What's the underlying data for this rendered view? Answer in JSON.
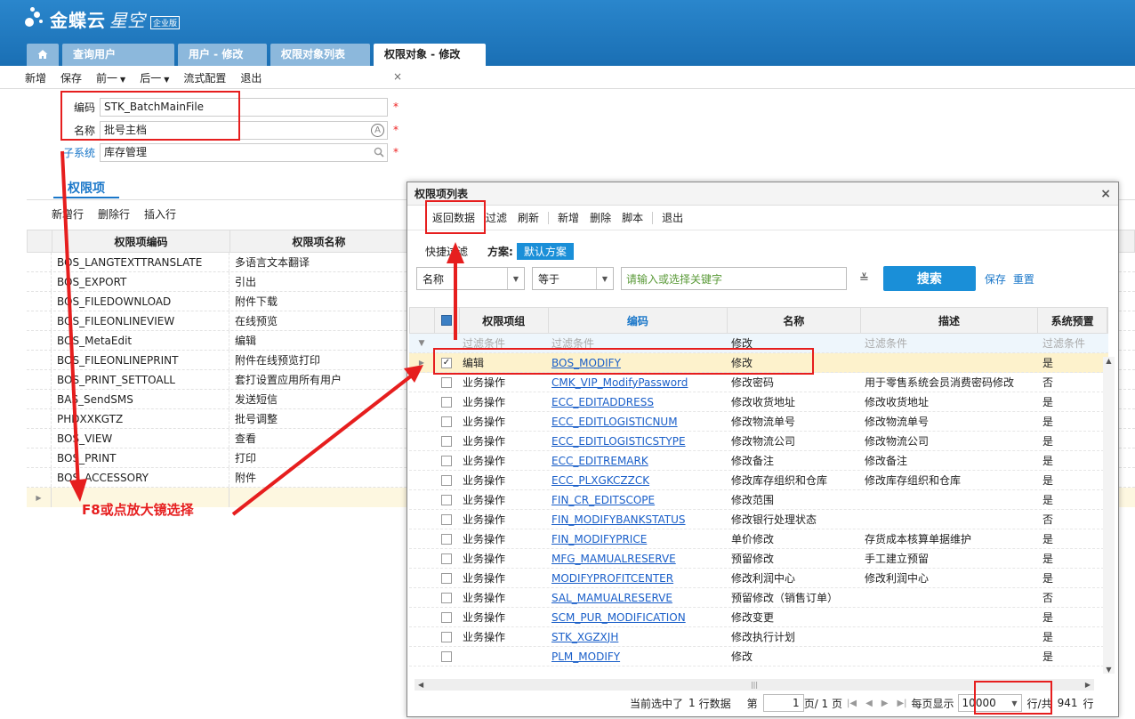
{
  "app": {
    "name": "金蝶云",
    "name2": "星空",
    "edition": "企业版"
  },
  "tabs": [
    {
      "label": "查询用户",
      "active": false
    },
    {
      "label": "用户 - 修改",
      "active": false
    },
    {
      "label": "权限对象列表",
      "active": false
    },
    {
      "label": "权限对象 - 修改",
      "active": true,
      "close": "×"
    }
  ],
  "toolbar": {
    "new": "新增",
    "save": "保存",
    "prev": "前一",
    "next": "后一",
    "flow": "流式配置",
    "exit": "退出"
  },
  "form": {
    "code_label": "编码",
    "code_value": "STK_BatchMainFile",
    "name_label": "名称",
    "name_value": "批号主档",
    "sub_label": "子系统",
    "sub_value": "库存管理",
    "star": "*",
    "lang_icon": "A"
  },
  "section": {
    "tab": "权限项",
    "add_row": "新增行",
    "del_row": "删除行",
    "insert_row": "插入行",
    "col_code": "权限项编码",
    "col_name": "权限项名称"
  },
  "perm_rows": [
    {
      "code": "BOS_LANGTEXTTRANSLATE",
      "name": "多语言文本翻译"
    },
    {
      "code": "BOS_EXPORT",
      "name": "引出"
    },
    {
      "code": "BOS_FILEDOWNLOAD",
      "name": "附件下载"
    },
    {
      "code": "BOS_FILEONLINEVIEW",
      "name": "在线预览"
    },
    {
      "code": "BOS_MetaEdit",
      "name": "编辑"
    },
    {
      "code": "BOS_FILEONLINEPRINT",
      "name": "附件在线预览打印"
    },
    {
      "code": "BOS_PRINT_SETTOALL",
      "name": "套打设置应用所有用户"
    },
    {
      "code": "BAS_SendSMS",
      "name": "发送短信"
    },
    {
      "code": "PHDXXKGTZ",
      "name": "批号调整"
    },
    {
      "code": "BOS_VIEW",
      "name": "查看"
    },
    {
      "code": "BOS_PRINT",
      "name": "打印"
    },
    {
      "code": "BOS_ACCESSORY",
      "name": "附件"
    }
  ],
  "annotation": "F8或点放大镜选择",
  "dialog": {
    "title": "权限项列表",
    "close": "×",
    "toolbar": {
      "return": "返回数据",
      "filter": "过滤",
      "refresh": "刷新",
      "new": "新增",
      "delete": "删除",
      "script": "脚本",
      "exit": "退出"
    },
    "quick_filter": "快捷过滤",
    "scheme_label": "方案:",
    "scheme_value": "默认方案",
    "field": "名称",
    "op": "等于",
    "keyword_placeholder": "请输入或选择关键字",
    "search": "搜索",
    "save": "保存",
    "reset": "重置",
    "columns": {
      "group": "权限项组",
      "code": "编码",
      "name": "名称",
      "desc": "描述",
      "sys": "系统预置"
    },
    "filter_hint": "过滤条件",
    "filter_name": "修改",
    "rows": [
      {
        "group": "编辑",
        "code": "BOS_MODIFY",
        "name": "修改",
        "desc": "",
        "sys": "是",
        "checked": true
      },
      {
        "group": "业务操作",
        "code": "CMK_VIP_ModifyPassword",
        "name": "修改密码",
        "desc": "用于零售系统会员消费密码修改",
        "sys": "否"
      },
      {
        "group": "业务操作",
        "code": "ECC_EDITADDRESS",
        "name": "修改收货地址",
        "desc": "修改收货地址",
        "sys": "是"
      },
      {
        "group": "业务操作",
        "code": "ECC_EDITLOGISTICNUM",
        "name": "修改物流单号",
        "desc": "修改物流单号",
        "sys": "是"
      },
      {
        "group": "业务操作",
        "code": "ECC_EDITLOGISTICSTYPE",
        "name": "修改物流公司",
        "desc": "修改物流公司",
        "sys": "是"
      },
      {
        "group": "业务操作",
        "code": "ECC_EDITREMARK",
        "name": "修改备注",
        "desc": "修改备注",
        "sys": "是"
      },
      {
        "group": "业务操作",
        "code": "ECC_PLXGKCZZCK",
        "name": "修改库存组织和仓库",
        "desc": "修改库存组织和仓库",
        "sys": "是"
      },
      {
        "group": "业务操作",
        "code": "FIN_CR_EDITSCOPE",
        "name": "修改范围",
        "desc": "",
        "sys": "是"
      },
      {
        "group": "业务操作",
        "code": "FIN_MODIFYBANKSTATUS",
        "name": "修改银行处理状态",
        "desc": "",
        "sys": "否"
      },
      {
        "group": "业务操作",
        "code": "FIN_MODIFYPRICE",
        "name": "单价修改",
        "desc": "存货成本核算单据维护",
        "sys": "是"
      },
      {
        "group": "业务操作",
        "code": "MFG_MAMUALRESERVE",
        "name": "预留修改",
        "desc": "手工建立预留",
        "sys": "是"
      },
      {
        "group": "业务操作",
        "code": "MODIFYPROFITCENTER",
        "name": "修改利润中心",
        "desc": "修改利润中心",
        "sys": "是"
      },
      {
        "group": "业务操作",
        "code": "SAL_MAMUALRESERVE",
        "name": "预留修改（销售订单）",
        "desc": "",
        "sys": "否"
      },
      {
        "group": "业务操作",
        "code": "SCM_PUR_MODIFICATION",
        "name": "修改变更",
        "desc": "",
        "sys": "是"
      },
      {
        "group": "业务操作",
        "code": "STK_XGZXJH",
        "name": "修改执行计划",
        "desc": "",
        "sys": "是"
      },
      {
        "group": "",
        "code": "PLM_MODIFY",
        "name": "修改",
        "desc": "",
        "sys": "是"
      }
    ],
    "pager": {
      "selected_prefix": "当前选中了",
      "selected_count": "1",
      "selected_suffix": "行数据",
      "page_prefix": "第",
      "page_num": "1",
      "page_of": "页/ 1 页",
      "per_page_label": "每页显示",
      "per_page": "10000",
      "rows_total": "行/共",
      "total": "941",
      "total_suffix": "行"
    }
  },
  "colors": {
    "header": "#1a6fb4",
    "accent": "#1a8fd8",
    "annotation": "#e61e1e"
  }
}
